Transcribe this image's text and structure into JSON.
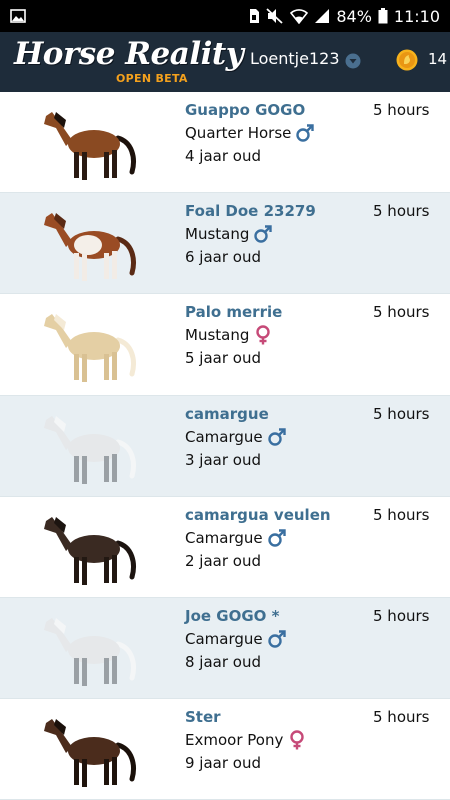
{
  "status_bar": {
    "battery_percent": "84%",
    "time": "11:10",
    "icons": [
      "image-icon",
      "sim-icon",
      "mute-icon",
      "wifi-icon",
      "signal-icon",
      "battery-icon"
    ]
  },
  "header": {
    "logo_title": "Horse Reality",
    "logo_subtitle": "OPEN BETA",
    "username": "Loentje123",
    "coin_count": "14",
    "colors": {
      "header_bg": "#1e2c3a",
      "accent": "#f4a11d",
      "link": "#3f6f90"
    }
  },
  "horses": [
    {
      "name": "Guappo GOGO",
      "breed": "Quarter Horse",
      "gender": "male",
      "age": "4 jaar oud",
      "time": "5 hours",
      "coat": "bay"
    },
    {
      "name": "Foal Doe 23279",
      "breed": "Mustang",
      "gender": "male",
      "age": "6 jaar oud",
      "time": "5 hours",
      "coat": "pinto"
    },
    {
      "name": "Palo merrie",
      "breed": "Mustang",
      "gender": "female",
      "age": "5 jaar oud",
      "time": "5 hours",
      "coat": "palomino"
    },
    {
      "name": "camargue",
      "breed": "Camargue",
      "gender": "male",
      "age": "3 jaar oud",
      "time": "5 hours",
      "coat": "grey"
    },
    {
      "name": "camargua veulen",
      "breed": "Camargue",
      "gender": "male",
      "age": "2 jaar oud",
      "time": "5 hours",
      "coat": "dark-foal"
    },
    {
      "name": "Joe GOGO *",
      "breed": "Camargue",
      "gender": "male",
      "age": "8 jaar oud",
      "time": "5 hours",
      "coat": "grey"
    },
    {
      "name": "Ster",
      "breed": "Exmoor Pony",
      "gender": "female",
      "age": "9 jaar oud",
      "time": "5 hours",
      "coat": "dark-bay"
    }
  ]
}
